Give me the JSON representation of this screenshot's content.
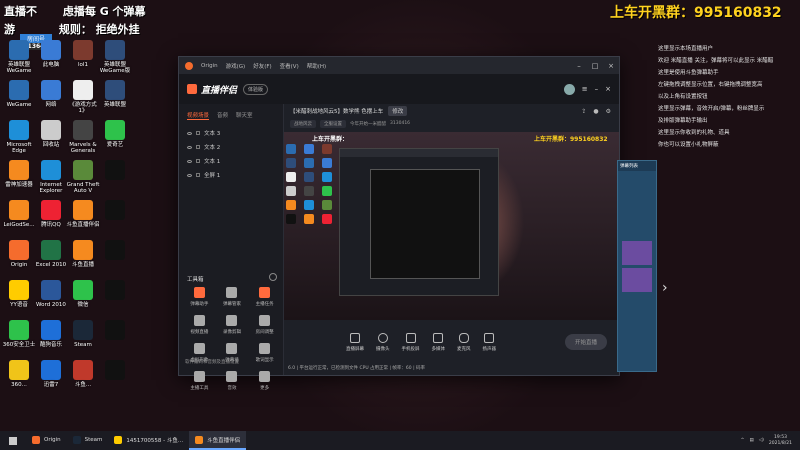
{
  "overlay": {
    "top_left_line1": "直播不",
    "top_left_line1b": "虑播每",
    "top_left_line1c": "G 个弹幕",
    "top_left_line2": "游",
    "top_left_line2b": "规则：",
    "top_left_line2c": "拒绝外挂",
    "room_label": "房间号",
    "room_number": "313641",
    "top_right": "上车开黑群：",
    "top_right_number": "995160832"
  },
  "desktop_icons": [
    {
      "label": "英雄联盟 WeGame",
      "color": "#2b6cb0"
    },
    {
      "label": "此电脑",
      "color": "#3a7bd5"
    },
    {
      "label": "lol1",
      "color": "#7c3a2e"
    },
    {
      "label": "英雄联盟 WeGame版",
      "color": "#2e4d7a"
    },
    {
      "label": "WeGame",
      "color": "#2b6cb0"
    },
    {
      "label": "网络",
      "color": "#3a7bd5"
    },
    {
      "label": "《游戏方式 1》",
      "color": "#eee"
    },
    {
      "label": "英雄联盟",
      "color": "#2e4d7a"
    },
    {
      "label": "Microsoft Edge",
      "color": "#1e8fd8"
    },
    {
      "label": "回收站",
      "color": "#ccc"
    },
    {
      "label": "Marvels & Generals",
      "color": "#444"
    },
    {
      "label": "爱奇艺",
      "color": "#2ec24b"
    },
    {
      "label": "雷神加速器",
      "color": "#f58a1f"
    },
    {
      "label": "Internet Explorer",
      "color": "#1e8fd8"
    },
    {
      "label": "Grand Theft Auto V",
      "color": "#5a8a3a"
    },
    {
      "label": "",
      "color": "#111"
    },
    {
      "label": "LeiGodSe...",
      "color": "#f58a1f"
    },
    {
      "label": "腾讯QQ",
      "color": "#e23"
    },
    {
      "label": "斗鱼直播伴侣",
      "color": "#f58a1f"
    },
    {
      "label": "",
      "color": "#111"
    },
    {
      "label": "Origin",
      "color": "#f56c2d"
    },
    {
      "label": "Excel 2010",
      "color": "#217346"
    },
    {
      "label": "斗鱼直播",
      "color": "#f58a1f"
    },
    {
      "label": "",
      "color": "#111"
    },
    {
      "label": "YY语音",
      "color": "#ffcc00"
    },
    {
      "label": "Word 2010",
      "color": "#2b579a"
    },
    {
      "label": "微信",
      "color": "#2ec24b"
    },
    {
      "label": "",
      "color": "#111"
    },
    {
      "label": "360安全卫士",
      "color": "#2ec24b"
    },
    {
      "label": "酷狗音乐",
      "color": "#1e6fd8"
    },
    {
      "label": "Steam",
      "color": "#1b2838"
    },
    {
      "label": "",
      "color": "#111"
    },
    {
      "label": "360...",
      "color": "#f0c419"
    },
    {
      "label": "迅雷7",
      "color": "#1e6fd8"
    },
    {
      "label": "斗鱼...",
      "color": "#c0392b"
    },
    {
      "label": "",
      "color": "#111"
    }
  ],
  "app": {
    "origin_menu": [
      "Origin",
      "游戏(G)",
      "好友(F)",
      "查看(V)",
      "帮助(H)"
    ],
    "brand": "直播伴侣",
    "brand_badge": "体验版",
    "side_tabs": [
      "视频场景",
      "音频",
      "聊天室"
    ],
    "scenes": [
      "文本 3",
      "文本 2",
      "文本 1",
      "全屏 1"
    ],
    "tools_title": "工具箱",
    "tools": [
      {
        "label": "弹幕助手",
        "color": "#ff6a3d"
      },
      {
        "label": "弹幕管家",
        "color": "#aaa"
      },
      {
        "label": "主播任务",
        "color": "#ff6a3d"
      },
      {
        "label": "视频直播",
        "color": "#aaa"
      },
      {
        "label": "录像剪辑",
        "color": "#aaa"
      },
      {
        "label": "房间调整",
        "color": "#aaa"
      },
      {
        "label": "虚拟形象",
        "color": "#aaa"
      },
      {
        "label": "弹幕墙",
        "color": "#aaa"
      },
      {
        "label": "歌词显示",
        "color": "#aaa"
      },
      {
        "label": "主播工具",
        "color": "#aaa"
      },
      {
        "label": "音效",
        "color": "#aaa"
      },
      {
        "label": "更多",
        "color": "#aaa"
      }
    ],
    "side_footer": "软件编码和音频及直播设置",
    "title": "【米醋刺战地风云5】数学熊 色摆上车",
    "title_tag": "修改",
    "sub_pills": [
      "战地风云",
      "全服设置"
    ],
    "sub_text": "今年开始一米醋醋",
    "sub_num": "3130416",
    "preview_overlay_left": "上车开黑群：",
    "preview_overlay_right": "上车开黑群：995160832",
    "bottom_tools": [
      "直播屏幕",
      "摄像头",
      "手机投屏",
      "多媒体",
      "麦克风",
      "扬声器"
    ],
    "go_live": "开始直播",
    "status_footer": "6.0 | 平台运行正常，已检测到文件 CPU 占用正常 | 帧率：60 | 码率"
  },
  "chat": {
    "lines": [
      "这里显示本场直播用户",
      "欢迎 米醋直播 关注，弹幕将可以此显示 米醋醋",
      "",
      "这里是使用斗鱼弹幕助手",
      "左键拖拽调整显示位置，右键拖拽调整宽高",
      "以及上角有设置按钮",
      "这里显示弹幕，音效开启/弹幕，粉丝牌显示",
      "及排版弹幕助手输出",
      "",
      "这里显示你收到的礼物、道具",
      "你也可以设置小礼物屏蔽"
    ],
    "widget_header": "弹幕列表"
  },
  "taskbar": {
    "items": [
      {
        "label": "Origin",
        "color": "#f56c2d",
        "active": false
      },
      {
        "label": "Steam",
        "color": "#1b2838",
        "active": false
      },
      {
        "label": "1451700558 - 斗鱼...",
        "color": "#ffcc00",
        "active": false
      },
      {
        "label": "斗鱼直播伴侣",
        "color": "#f58a1f",
        "active": true
      }
    ],
    "time": "19:53",
    "date": "2021/8/21"
  }
}
